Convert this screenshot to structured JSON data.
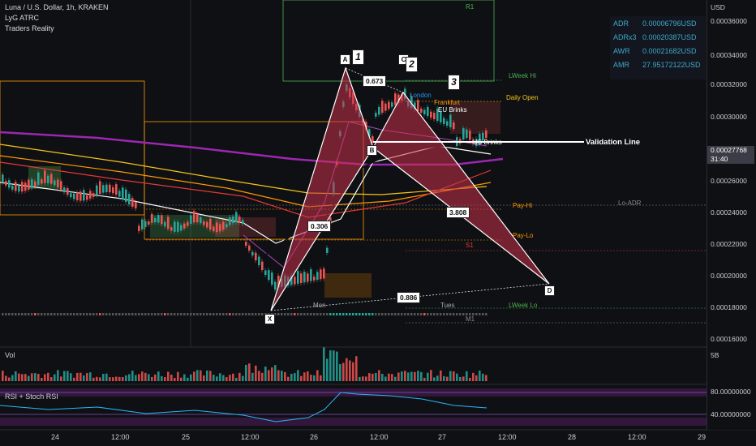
{
  "header": {
    "title": "Luna / U.S. Dollar, 1h, KRAKEN",
    "indicators": [
      "LyG ATRC",
      "Traders Reality"
    ]
  },
  "stats": [
    {
      "key": "ADR",
      "value": "0.00006796USD"
    },
    {
      "key": "ADRx3",
      "value": "0.00020387USD"
    },
    {
      "key": "AWR",
      "value": "0.00021682USD"
    },
    {
      "key": "AMR",
      "value": "27.95172122USD"
    }
  ],
  "price_axis": {
    "currency": "USD",
    "ticks": [
      "0.00036000",
      "0.00034000",
      "0.00032000",
      "0.00030000",
      "0.00026000",
      "0.00024000",
      "0.00022000",
      "0.00020000",
      "0.00018000",
      "0.00016000"
    ],
    "current_price": "0.00027768",
    "countdown": "31:40"
  },
  "time_axis": [
    "24",
    "12:00",
    "25",
    "12:00",
    "26",
    "12:00",
    "27",
    "12:00",
    "28",
    "12:00",
    "29"
  ],
  "pattern": {
    "points": [
      "X",
      "A",
      "B",
      "C",
      "D"
    ],
    "ratios": {
      "xab": "0.673",
      "abc": "0.306",
      "bcd": "3.808",
      "xad": "0.886"
    },
    "steps": [
      "1",
      "2",
      "3"
    ],
    "validation_label": "Validation Line"
  },
  "levels": {
    "lweek_hi": "LWeek Hi",
    "lweek_lo": "LWeek Lo",
    "daily_open": "Daily Open",
    "eu_brinks": "EU Brinks",
    "us_brinks": "US Brinks",
    "frankfurt": "Frankfurt",
    "london": "London",
    "lo_adr": "Lo-ADR",
    "pay_hi": "Pay-Hi",
    "pay_lo": "Pay-Lo",
    "s1": "S1",
    "r1": "R1",
    "m1": "M1",
    "tues": "Tues",
    "mon": "Mon"
  },
  "panes": {
    "volume_label": "Vol",
    "volume_scale": "5B",
    "rsi_label": "RSI + Stoch RSI",
    "rsi_ticks": [
      "80.00000000",
      "40.00000000"
    ]
  },
  "colors": {
    "bull": "#26a69a",
    "bear": "#ef5350",
    "pattern_fill": "#c9314a",
    "ema_purple": "#9c27b0",
    "background": "#0f1014"
  }
}
